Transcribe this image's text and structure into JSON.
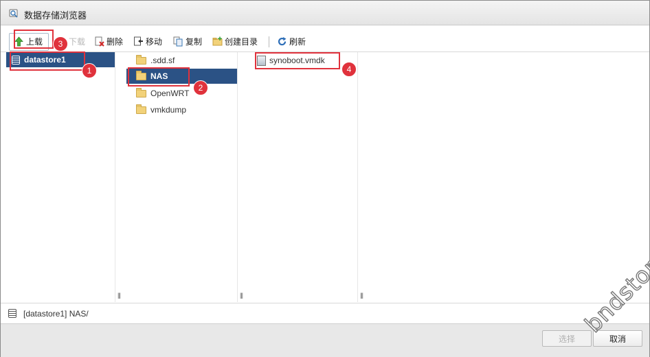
{
  "dialog": {
    "title": "数据存储浏览器",
    "title_icon": "datastore-browser-icon"
  },
  "toolbar": {
    "upload": "上载",
    "download": "下载",
    "delete": "删除",
    "move": "移动",
    "copy": "复制",
    "create_dir": "创建目录",
    "refresh": "刷新"
  },
  "columns": {
    "datastores": [
      {
        "label": "datastore1",
        "selected": true
      }
    ],
    "folders": [
      {
        "label": ".sdd.sf",
        "selected": false
      },
      {
        "label": "NAS",
        "selected": true
      },
      {
        "label": "OpenWRT",
        "selected": false
      },
      {
        "label": "vmkdump",
        "selected": false
      }
    ],
    "files": [
      {
        "label": "synoboot.vmdk",
        "selected": false
      }
    ],
    "resize_grip": "|||"
  },
  "path": {
    "value": "[datastore1] NAS/"
  },
  "annotations": {
    "badges": [
      "1",
      "2",
      "3",
      "4"
    ],
    "color": "#e0323c"
  },
  "footer": {
    "select": "选择",
    "cancel": "取消"
  },
  "watermark": "bndstone.com",
  "colors": {
    "selection": "#2b5285",
    "folder": "#f2d27a"
  }
}
